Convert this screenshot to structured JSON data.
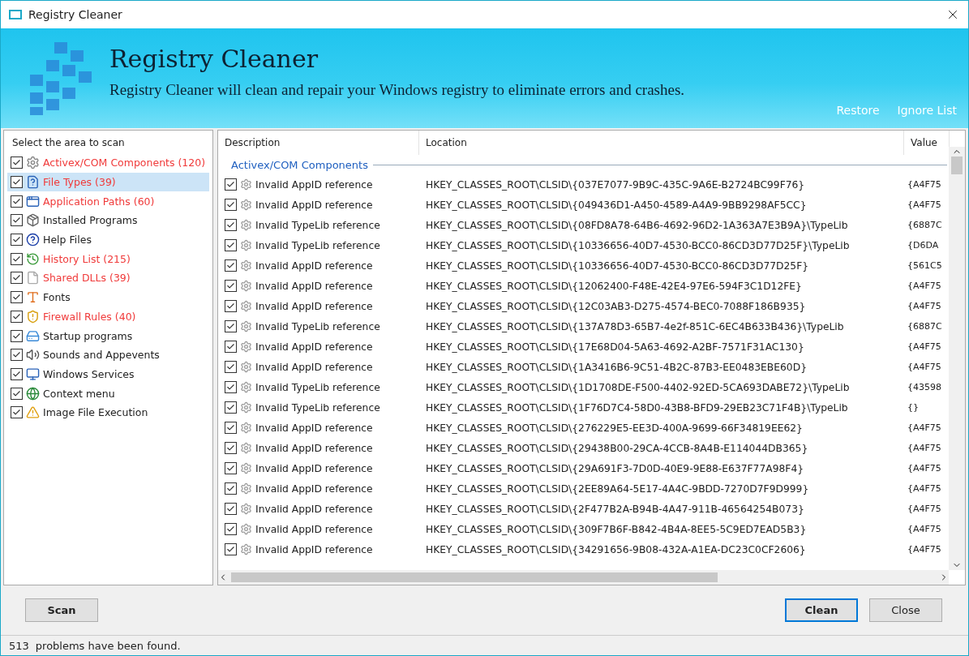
{
  "window": {
    "title": "Registry Cleaner"
  },
  "header": {
    "title": "Registry Cleaner",
    "subtitle": "Registry Cleaner will clean and repair your Windows registry to eliminate errors and crashes.",
    "links": [
      "Restore",
      "Ignore List"
    ]
  },
  "sidebar": {
    "heading": "Select the area to scan",
    "items": [
      {
        "label": "Activex/COM Components (120)",
        "kind": "gear",
        "checked": true,
        "flagged": true,
        "selected": false
      },
      {
        "label": "File Types (39)",
        "kind": "question-file",
        "checked": true,
        "flagged": true,
        "selected": true
      },
      {
        "label": "Application Paths (60)",
        "kind": "window",
        "checked": true,
        "flagged": true,
        "selected": false
      },
      {
        "label": "Installed Programs",
        "kind": "package",
        "checked": true,
        "flagged": false,
        "selected": false
      },
      {
        "label": "Help Files",
        "kind": "help",
        "checked": true,
        "flagged": false,
        "selected": false
      },
      {
        "label": "History List (215)",
        "kind": "history",
        "checked": true,
        "flagged": true,
        "selected": false
      },
      {
        "label": "Shared DLLs (39)",
        "kind": "file",
        "checked": true,
        "flagged": true,
        "selected": false
      },
      {
        "label": "Fonts",
        "kind": "font",
        "checked": true,
        "flagged": false,
        "selected": false
      },
      {
        "label": "Firewall Rules (40)",
        "kind": "shield",
        "checked": true,
        "flagged": true,
        "selected": false
      },
      {
        "label": "Startup programs",
        "kind": "drive",
        "checked": true,
        "flagged": false,
        "selected": false
      },
      {
        "label": "Sounds and Appevents",
        "kind": "speaker",
        "checked": true,
        "flagged": false,
        "selected": false
      },
      {
        "label": "Windows Services",
        "kind": "monitor",
        "checked": true,
        "flagged": false,
        "selected": false
      },
      {
        "label": "Context menu",
        "kind": "globe",
        "checked": true,
        "flagged": false,
        "selected": false
      },
      {
        "label": "Image File Execution",
        "kind": "warning",
        "checked": true,
        "flagged": false,
        "selected": false
      }
    ]
  },
  "table": {
    "columns": [
      "Description",
      "Location",
      "Value"
    ],
    "group": "Activex/COM Components",
    "rows": [
      {
        "description": "Invalid AppID reference",
        "location": "HKEY_CLASSES_ROOT\\CLSID\\{037E7077-9B9C-435C-9A6E-B2724BC99F76}",
        "value": "{A4F75",
        "checked": true
      },
      {
        "description": "Invalid AppID reference",
        "location": "HKEY_CLASSES_ROOT\\CLSID\\{049436D1-A450-4589-A4A9-9BB9298AF5CC}",
        "value": "{A4F75",
        "checked": true
      },
      {
        "description": "Invalid TypeLib reference",
        "location": "HKEY_CLASSES_ROOT\\CLSID\\{08FD8A78-64B6-4692-96D2-1A363A7E3B9A}\\TypeLib",
        "value": "{6887C",
        "checked": true
      },
      {
        "description": "Invalid TypeLib reference",
        "location": "HKEY_CLASSES_ROOT\\CLSID\\{10336656-40D7-4530-BCC0-86CD3D77D25F}\\TypeLib",
        "value": "{D6DA",
        "checked": true
      },
      {
        "description": "Invalid AppID reference",
        "location": "HKEY_CLASSES_ROOT\\CLSID\\{10336656-40D7-4530-BCC0-86CD3D77D25F}",
        "value": "{561C5",
        "checked": true
      },
      {
        "description": "Invalid AppID reference",
        "location": "HKEY_CLASSES_ROOT\\CLSID\\{12062400-F48E-42E4-97E6-594F3C1D12FE}",
        "value": "{A4F75",
        "checked": true
      },
      {
        "description": "Invalid AppID reference",
        "location": "HKEY_CLASSES_ROOT\\CLSID\\{12C03AB3-D275-4574-BEC0-7088F186B935}",
        "value": "{A4F75",
        "checked": true
      },
      {
        "description": "Invalid TypeLib reference",
        "location": "HKEY_CLASSES_ROOT\\CLSID\\{137A78D3-65B7-4e2f-851C-6EC4B633B436}\\TypeLib",
        "value": "{6887C",
        "checked": true
      },
      {
        "description": "Invalid AppID reference",
        "location": "HKEY_CLASSES_ROOT\\CLSID\\{17E68D04-5A63-4692-A2BF-7571F31AC130}",
        "value": "{A4F75",
        "checked": true
      },
      {
        "description": "Invalid AppID reference",
        "location": "HKEY_CLASSES_ROOT\\CLSID\\{1A3416B6-9C51-4B2C-87B3-EE0483EBE60D}",
        "value": "{A4F75",
        "checked": true
      },
      {
        "description": "Invalid TypeLib reference",
        "location": "HKEY_CLASSES_ROOT\\CLSID\\{1D1708DE-F500-4402-92ED-5CA693DABE72}\\TypeLib",
        "value": "{43598",
        "checked": true
      },
      {
        "description": "Invalid TypeLib reference",
        "location": "HKEY_CLASSES_ROOT\\CLSID\\{1F76D7C4-58D0-43B8-BFD9-29EB23C71F4B}\\TypeLib",
        "value": "{}",
        "checked": true
      },
      {
        "description": "Invalid AppID reference",
        "location": "HKEY_CLASSES_ROOT\\CLSID\\{276229E5-EE3D-400A-9699-66F34819EE62}",
        "value": "{A4F75",
        "checked": true
      },
      {
        "description": "Invalid AppID reference",
        "location": "HKEY_CLASSES_ROOT\\CLSID\\{29438B00-29CA-4CCB-8A4B-E114044DB365}",
        "value": "{A4F75",
        "checked": true
      },
      {
        "description": "Invalid AppID reference",
        "location": "HKEY_CLASSES_ROOT\\CLSID\\{29A691F3-7D0D-40E9-9E88-E637F77A98F4}",
        "value": "{A4F75",
        "checked": true
      },
      {
        "description": "Invalid AppID reference",
        "location": "HKEY_CLASSES_ROOT\\CLSID\\{2EE89A64-5E17-4A4C-9BDD-7270D7F9D999}",
        "value": "{A4F75",
        "checked": true
      },
      {
        "description": "Invalid AppID reference",
        "location": "HKEY_CLASSES_ROOT\\CLSID\\{2F477B2A-B94B-4A47-911B-46564254B073}",
        "value": "{A4F75",
        "checked": true
      },
      {
        "description": "Invalid AppID reference",
        "location": "HKEY_CLASSES_ROOT\\CLSID\\{309F7B6F-B842-4B4A-8EE5-5C9ED7EAD5B3}",
        "value": "{A4F75",
        "checked": true
      },
      {
        "description": "Invalid AppID reference",
        "location": "HKEY_CLASSES_ROOT\\CLSID\\{34291656-9B08-432A-A1EA-DC23C0CF2606}",
        "value": "{A4F75",
        "checked": true
      }
    ]
  },
  "buttons": {
    "scan": "Scan",
    "clean": "Clean",
    "close": "Close"
  },
  "status_bar": {
    "count": "513",
    "message": "problems have been found."
  }
}
